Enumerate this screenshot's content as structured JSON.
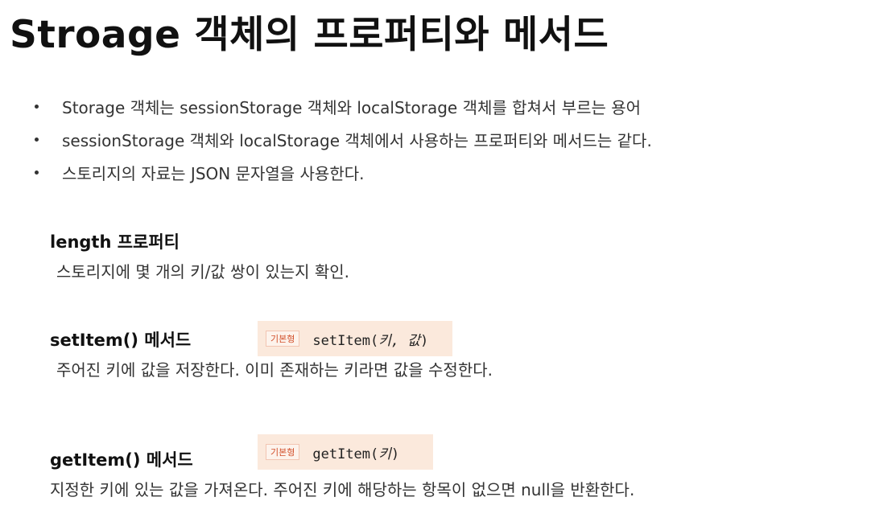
{
  "slide": {
    "title": "Stroage 객체의 프로퍼티와 메서드",
    "bullets": [
      "Storage 객체는 sessionStorage 객체와 localStorage 객체를 합쳐서 부르는 용어",
      "sessionStorage 객체와 localStorage 객체에서 사용하는 프로퍼티와 메서드는 같다.",
      "스토리지의 자료는 JSON 문자열을 사용한다."
    ],
    "sections": {
      "length": {
        "title": "length 프로퍼티",
        "description": "스토리지에 몇 개의 키/값 쌍이 있는지 확인."
      },
      "setItem": {
        "title": "setItem() 메서드",
        "badge": "기본형",
        "syntax_name": "setItem(",
        "syntax_args": "키, 값",
        "syntax_close": ")",
        "description": "주어진 키에 값을 저장한다. 이미 존재하는 키라면 값을 수정한다."
      },
      "getItem": {
        "title": "getItem() 메서드",
        "badge": "기본형",
        "syntax_name": "getItem(",
        "syntax_args": "키",
        "syntax_close": ")",
        "description": "지정한 키에 있는 값을 가져온다. 주어진 키에 해당하는 항목이 없으면 null을 반환한다."
      }
    },
    "colors": {
      "syntax_box_bg": "#fbe9dc",
      "badge_text": "#d2502b"
    }
  }
}
